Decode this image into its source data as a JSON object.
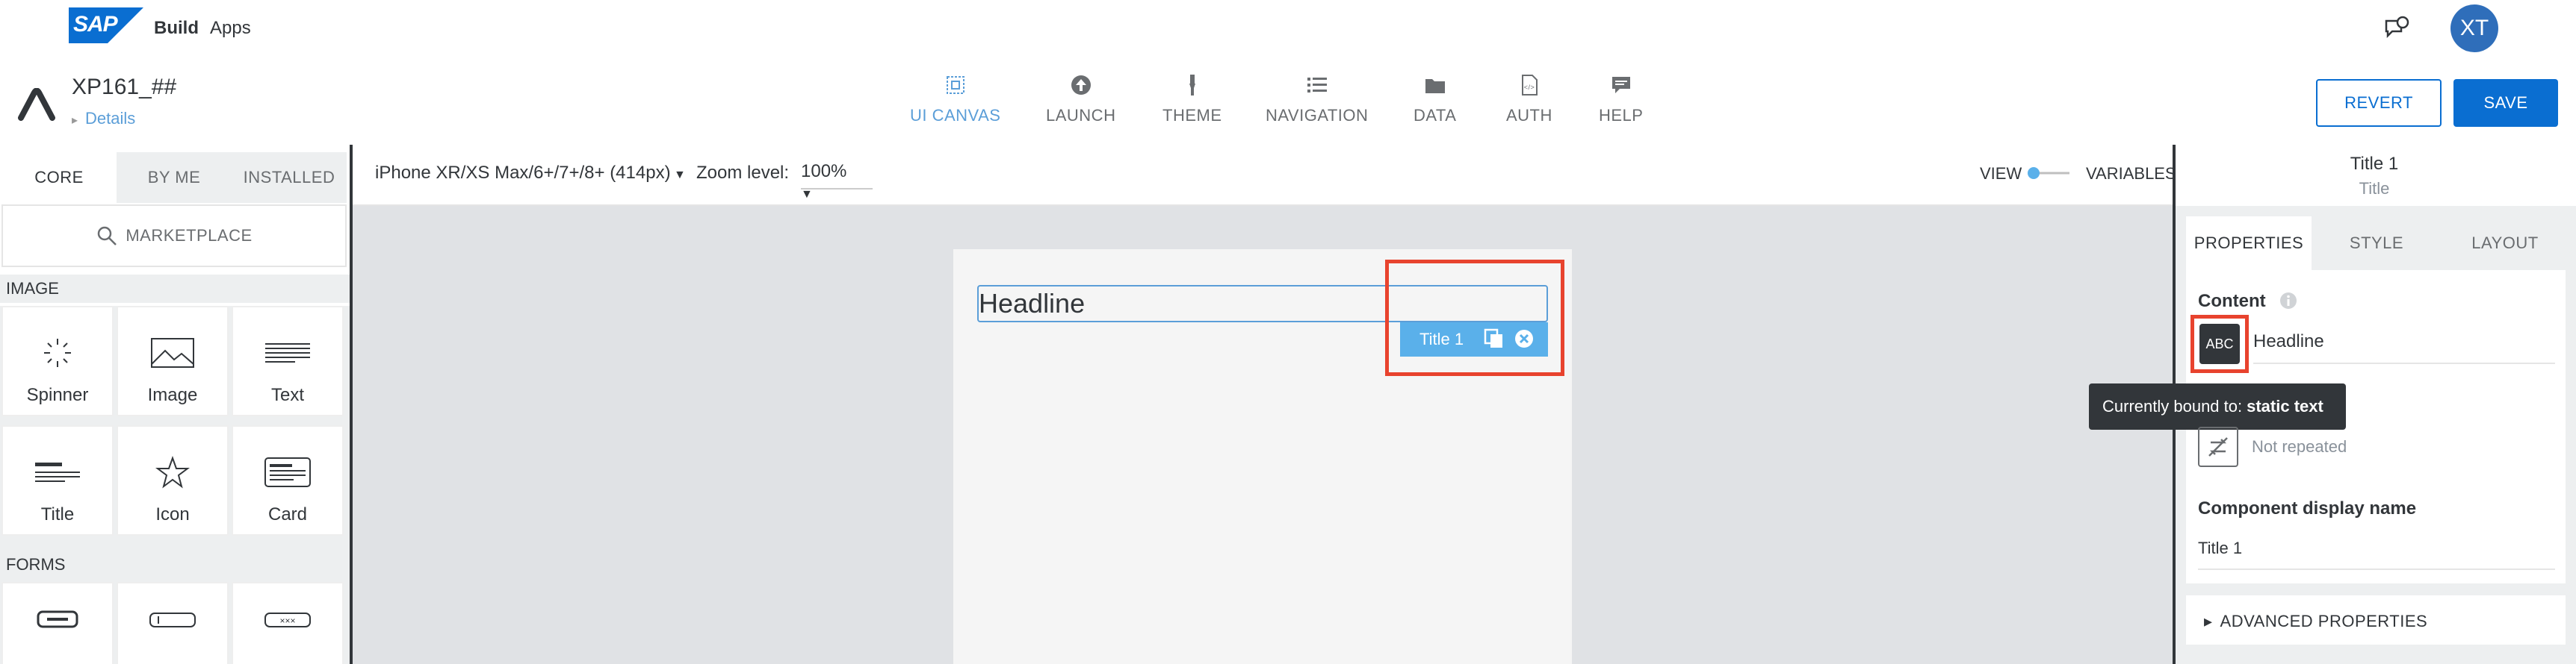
{
  "shell": {
    "logo_text": "SAP",
    "build": "Build",
    "apps": "Apps",
    "avatar_initials": "XT"
  },
  "app": {
    "project_name": "XP161_##",
    "details_link": "Details",
    "tabs": [
      {
        "label": "UI CANVAS",
        "icon": "ui-canvas-icon",
        "active": true
      },
      {
        "label": "LAUNCH",
        "icon": "launch-icon"
      },
      {
        "label": "THEME",
        "icon": "theme-icon"
      },
      {
        "label": "NAVIGATION",
        "icon": "navigation-icon"
      },
      {
        "label": "DATA",
        "icon": "data-icon"
      },
      {
        "label": "AUTH",
        "icon": "auth-icon"
      },
      {
        "label": "HELP",
        "icon": "help-icon"
      }
    ],
    "revert": "REVERT",
    "save": "SAVE"
  },
  "left": {
    "tabs": [
      "CORE",
      "BY ME",
      "INSTALLED"
    ],
    "marketplace": "MARKETPLACE",
    "sections": [
      {
        "title": "IMAGE",
        "items": [
          {
            "label": "Spinner",
            "icon": "spinner-icon"
          },
          {
            "label": "Image",
            "icon": "image-icon"
          },
          {
            "label": "Text",
            "icon": "text-icon"
          },
          {
            "label": "Title",
            "icon": "title-icon"
          },
          {
            "label": "Icon",
            "icon": "star-icon"
          },
          {
            "label": "Card",
            "icon": "card-icon"
          }
        ]
      },
      {
        "title": "FORMS",
        "items": [
          {
            "label": "",
            "icon": "button-icon"
          },
          {
            "label": "",
            "icon": "input-icon"
          },
          {
            "label": "",
            "icon": "password-icon"
          }
        ]
      }
    ]
  },
  "canvas": {
    "device": "iPhone XR/XS Max/6+/7+/8+ (414px)",
    "zoom_label": "Zoom level:",
    "zoom_value": "100%",
    "view": "VIEW",
    "variables": "VARIABLES",
    "headline": "Headline",
    "chip_label": "Title 1"
  },
  "right": {
    "title": "Title 1",
    "subtitle": "Title",
    "tabs": [
      "PROPERTIES",
      "STYLE",
      "LAYOUT"
    ],
    "content_label": "Content",
    "binding_icon_text": "ABC",
    "content_value": "Headline",
    "tooltip_prefix": "Currently bound to:",
    "tooltip_value": "static text",
    "repeat_value": "Not repeated",
    "display_name_label": "Component display name",
    "display_name_value": "Title 1",
    "advanced": "ADVANCED PROPERTIES"
  },
  "colors": {
    "accent": "#0a6ed1",
    "highlight": "#e8432e",
    "chip": "#5ab0ea"
  }
}
